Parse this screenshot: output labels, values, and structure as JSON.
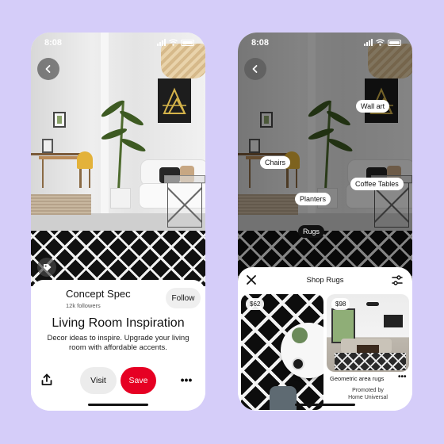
{
  "colors": {
    "background": "#d5cdf9",
    "save": "#e60023",
    "ink": "#111111"
  },
  "left_phone": {
    "status": {
      "time": "8:08"
    },
    "icons": {
      "back": "chevron-left-icon",
      "lens": "visual-search-icon",
      "share": "share-icon",
      "more": "more-icon"
    },
    "creator": {
      "name": "Concept Spec",
      "followers": "12k followers",
      "follow_label": "Follow"
    },
    "pin": {
      "title": "Living Room Inspiration",
      "description": "Decor ideas to inspire. Upgrade your living room with affordable accents."
    },
    "actions": {
      "visit_label": "Visit",
      "save_label": "Save",
      "more_label": "•••"
    }
  },
  "right_phone": {
    "status": {
      "time": "8:08"
    },
    "tags": [
      "Wall art",
      "Chairs",
      "Coffee Tables",
      "Planters",
      "Rugs"
    ],
    "selected_tag": "Rugs",
    "sheet": {
      "title": "Shop Rugs",
      "icons": {
        "close": "close-icon",
        "filter": "filter-icon"
      },
      "products": [
        {
          "price": "$62"
        },
        {
          "price": "$98",
          "name": "Geometric area rugs",
          "more": "•••",
          "promoted_line1": "Promoted by",
          "promoted_line2": "Home Universal"
        }
      ]
    }
  }
}
